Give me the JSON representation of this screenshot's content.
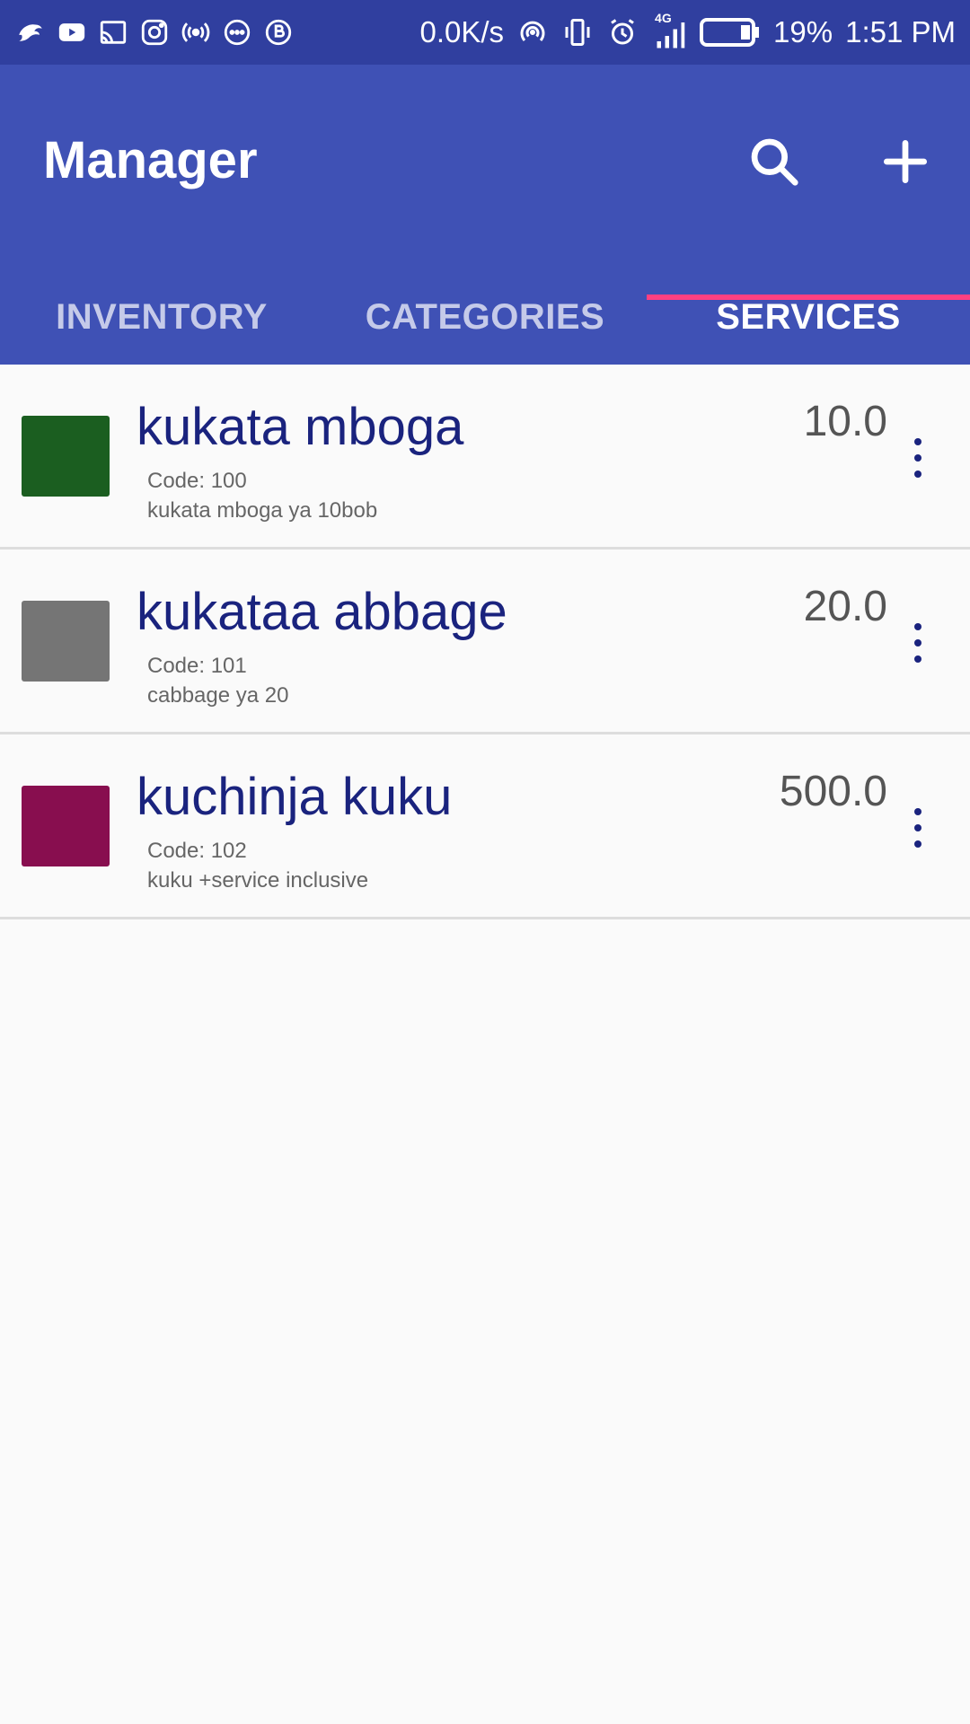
{
  "status_bar": {
    "left_icons": [
      "bird-app-icon",
      "youtube-icon",
      "cast-icon",
      "instagram-icon",
      "hotspot-icon",
      "messenger-icon",
      "b-app-icon"
    ],
    "net_speed": "0.0K/s",
    "network_label": "4G",
    "battery": "19%",
    "time": "1:51 PM"
  },
  "app_bar": {
    "title": "Manager",
    "actions": [
      "search-icon",
      "add-icon"
    ],
    "color": "#3F51B5"
  },
  "tabs": [
    {
      "label": "INVENTORY",
      "active": false
    },
    {
      "label": "CATEGORIES",
      "active": false
    },
    {
      "label": "SERVICES",
      "active": true
    }
  ],
  "accent_color": "#FF4081",
  "services": [
    {
      "name": "kukata mboga",
      "code": "Code: 100",
      "description": "kukata mboga ya 10bob",
      "price": "10.0",
      "color": "#1B5E20"
    },
    {
      "name": "kukataa abbage",
      "code": "Code: 101",
      "description": "cabbage ya 20",
      "price": "20.0",
      "color": "#757575"
    },
    {
      "name": "kuchinja kuku",
      "code": "Code: 102",
      "description": "kuku +service inclusive",
      "price": "500.0",
      "color": "#880E4F"
    }
  ]
}
